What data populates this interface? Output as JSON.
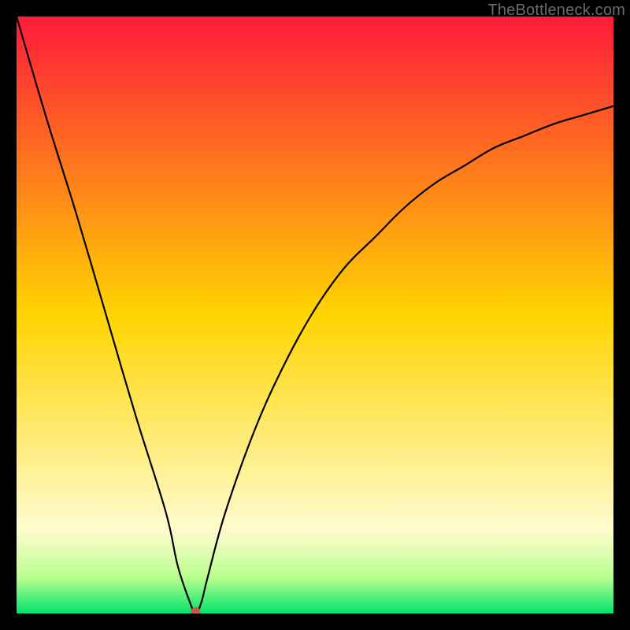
{
  "watermark": "TheBottleneck.com",
  "chart_data": {
    "type": "line",
    "title": "",
    "xlabel": "",
    "ylabel": "",
    "xlim": [
      0,
      100
    ],
    "ylim": [
      0,
      100
    ],
    "minimum_x": 30,
    "series": [
      {
        "name": "curve",
        "x": [
          0,
          5,
          10,
          15,
          20,
          25,
          27,
          29,
          30,
          31,
          32,
          35,
          40,
          45,
          50,
          55,
          60,
          65,
          70,
          75,
          80,
          85,
          90,
          95,
          100
        ],
        "y": [
          100,
          83,
          67,
          50,
          33,
          17,
          8,
          2,
          0,
          2,
          6,
          17,
          31,
          42,
          51,
          58,
          63,
          68,
          72,
          75,
          78,
          80,
          82,
          83.5,
          85
        ]
      }
    ],
    "marker": {
      "x": 30,
      "y": 0,
      "color": "#c95b4d"
    },
    "background_gradient": {
      "stops": [
        {
          "pct": 0,
          "color": "#ff1a3a"
        },
        {
          "pct": 50,
          "color": "#ffd400"
        },
        {
          "pct": 86,
          "color": "#fffccf"
        },
        {
          "pct": 94,
          "color": "#b9ff8f"
        },
        {
          "pct": 100,
          "color": "#00e36b"
        }
      ]
    }
  }
}
